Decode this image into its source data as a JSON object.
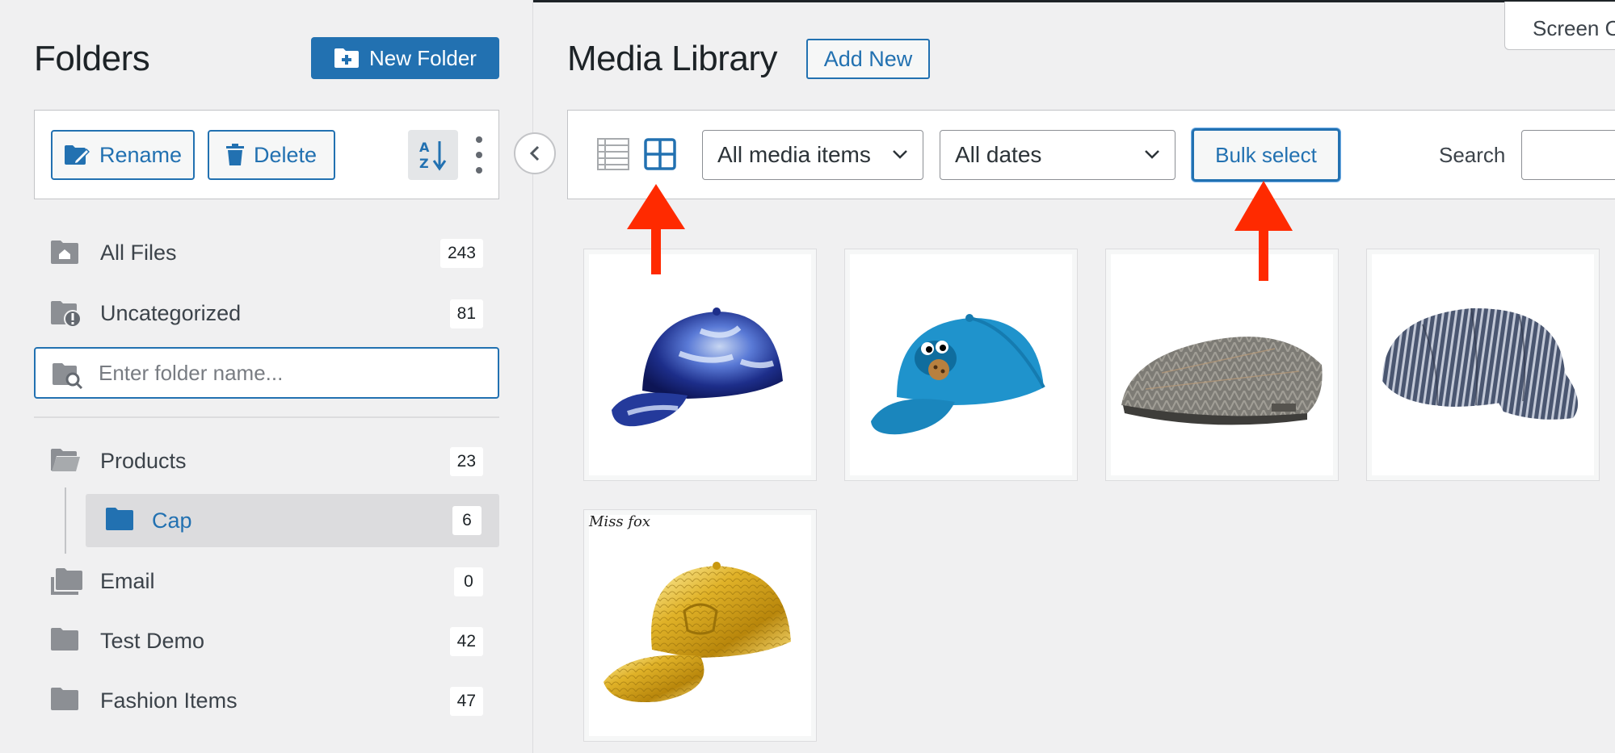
{
  "sidebar": {
    "title": "Folders",
    "new_folder_label": "New Folder",
    "rename_label": "Rename",
    "delete_label": "Delete",
    "search_placeholder": "Enter folder name...",
    "folders": {
      "all_files": {
        "label": "All Files",
        "count": "243"
      },
      "uncategorized": {
        "label": "Uncategorized",
        "count": "81"
      },
      "products": {
        "label": "Products",
        "count": "23"
      },
      "cap": {
        "label": "Cap",
        "count": "6"
      },
      "email": {
        "label": "Email",
        "count": "0"
      },
      "test_demo": {
        "label": "Test Demo",
        "count": "42"
      },
      "fashion_items": {
        "label": "Fashion Items",
        "count": "47"
      }
    }
  },
  "main": {
    "title": "Media Library",
    "add_new_label": "Add New",
    "screen_options_label": "Screen Options",
    "filters": {
      "media_type": "All media items",
      "dates": "All dates",
      "bulk_select_label": "Bulk select",
      "search_label": "Search"
    },
    "thumbnails": [
      {
        "name": "tie-dye-blue-cap"
      },
      {
        "name": "cookie-monster-cap"
      },
      {
        "name": "herringbone-flat-cap"
      },
      {
        "name": "striped-engineer-cap"
      },
      {
        "name": "gold-snapback-cap",
        "brand_text": "Miss fox"
      }
    ]
  },
  "colors": {
    "accent": "#2271b1",
    "background": "#f0f0f1",
    "annotation_arrow": "#ff2a00"
  }
}
